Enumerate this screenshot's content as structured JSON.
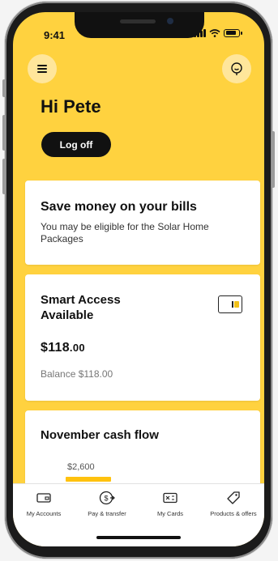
{
  "status": {
    "time": "9:41"
  },
  "header": {
    "greeting": "Hi Pete",
    "logoff_label": "Log off"
  },
  "promo": {
    "title": "Save money on your bills",
    "subtitle": "You may be eligible for the Solar Home Packages"
  },
  "account": {
    "name": "Smart Access Available",
    "amount_main": "$118",
    "amount_cents": ".00",
    "balance": "Balance $118.00"
  },
  "cashflow": {
    "title": "November cash flow",
    "bar_label": "$2,600"
  },
  "tabs": [
    {
      "label": "My Accounts"
    },
    {
      "label": "Pay & transfer"
    },
    {
      "label": "My Cards"
    },
    {
      "label": "Products & offers"
    }
  ],
  "colors": {
    "brand_yellow": "#ffd23f",
    "bar_yellow": "#ffc20e",
    "dark": "#111111"
  }
}
